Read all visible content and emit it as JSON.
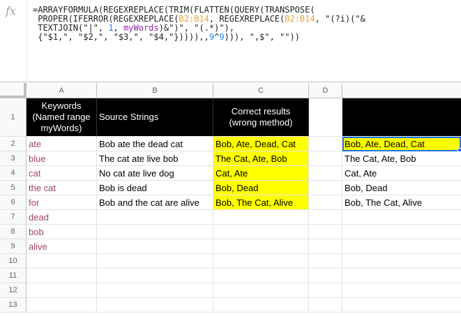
{
  "formula_bar": {
    "icon": "fx",
    "lines": [
      [
        "=ARRAYFORMULA(REGEXREPLACE(TRIM(FLATTEN(QUERY(TRANSPOSE(",
        null,
        null,
        null,
        null
      ],
      [
        " PROPER(IFERROR(REGEXREPLACE(",
        "B2:B14",
        ", REGEXREPLACE(",
        "B2:B14",
        ", \"(?i)(\"&"
      ],
      [
        " TEXTJOIN(\"|\", ",
        "1",
        ", ",
        "myWords",
        ")&\")\", \"(.*)\"),"
      ],
      [
        " {\"$1,\", \"$2,\", \"$3,\", \"$4,\"})))),,",
        "9",
        "^",
        "9",
        "))), \",$\", \"\"))"
      ]
    ]
  },
  "columns": [
    "A",
    "B",
    "C",
    "D",
    ""
  ],
  "rows": [
    "1",
    "2",
    "3",
    "4",
    "5",
    "6",
    "7",
    "8",
    "9",
    "10",
    "11",
    "12",
    "13"
  ],
  "header": {
    "a": "Keywords (Named range myWords)",
    "b": "Source Strings",
    "c": "Correct results (wrong method)",
    "d": "",
    "e": ""
  },
  "data": [
    {
      "a": "ate",
      "b": "Bob ate the dead cat",
      "c": "Bob, Ate, Dead, Cat",
      "e": "Bob, Ate, Dead, Cat"
    },
    {
      "a": "blue",
      "b": "The cat ate live bob",
      "c": "The Cat, Ate, Bob",
      "e": "The Cat, Ate, Bob"
    },
    {
      "a": "cat",
      "b": "No cat ate live dog",
      "c": "Cat, Ate",
      "e": "Cat, Ate"
    },
    {
      "a": "the cat",
      "b": "Bob is dead",
      "c": "Bob, Dead",
      "e": "Bob, Dead"
    },
    {
      "a": "for",
      "b": "Bob and the cat are alive",
      "c": "Bob, The Cat, Alive",
      "e": "Bob, The Cat, Alive"
    },
    {
      "a": "dead",
      "b": "",
      "c": "",
      "e": ""
    },
    {
      "a": "bob",
      "b": "",
      "c": "",
      "e": ""
    },
    {
      "a": "alive",
      "b": "",
      "c": "",
      "e": ""
    }
  ],
  "colors": {
    "highlight": "#ffff00",
    "header_bg": "#000000",
    "keyword_text": "#a0455a",
    "selection": "#1a73e8",
    "range_token": "#e8a33b",
    "named_range_token": "#8e24aa",
    "number_token": "#1e88e5"
  }
}
